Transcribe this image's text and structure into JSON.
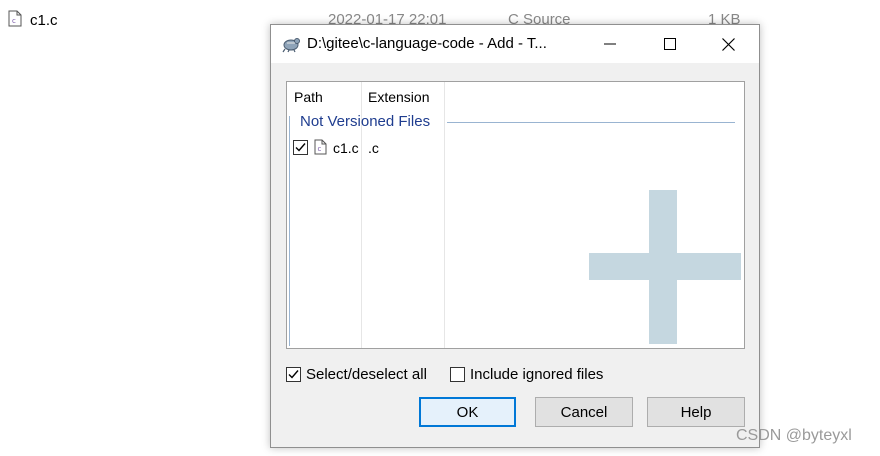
{
  "background_file": {
    "name": "c1.c",
    "date": "2022-01-17 22:01",
    "type": "C Source",
    "size": "1 KB",
    "icon": "c-source-file-icon"
  },
  "dialog": {
    "title": "D:\\gitee\\c-language-code - Add - T...",
    "title_icon": "tortoisegit-icon",
    "window_buttons": {
      "minimize": "minimize-icon",
      "maximize": "maximize-icon",
      "close": "close-icon"
    },
    "list": {
      "columns": [
        "Path",
        "Extension"
      ],
      "group": "Not Versioned Files",
      "rows": [
        {
          "checked": true,
          "path": "c1.c",
          "extension": ".c",
          "icon": "c-source-file-icon"
        }
      ],
      "watermark": "plus-icon"
    },
    "select_all": {
      "label": "Select/deselect all",
      "checked": true
    },
    "include_ignored": {
      "label": "Include ignored files",
      "checked": false
    },
    "buttons": {
      "ok": "OK",
      "cancel": "Cancel",
      "help": "Help"
    }
  },
  "credit": "CSDN @byteyxl",
  "colors": {
    "group_text": "#1f3d8f",
    "focus_border": "#0078d7",
    "watermark": "#c5d7e0"
  }
}
